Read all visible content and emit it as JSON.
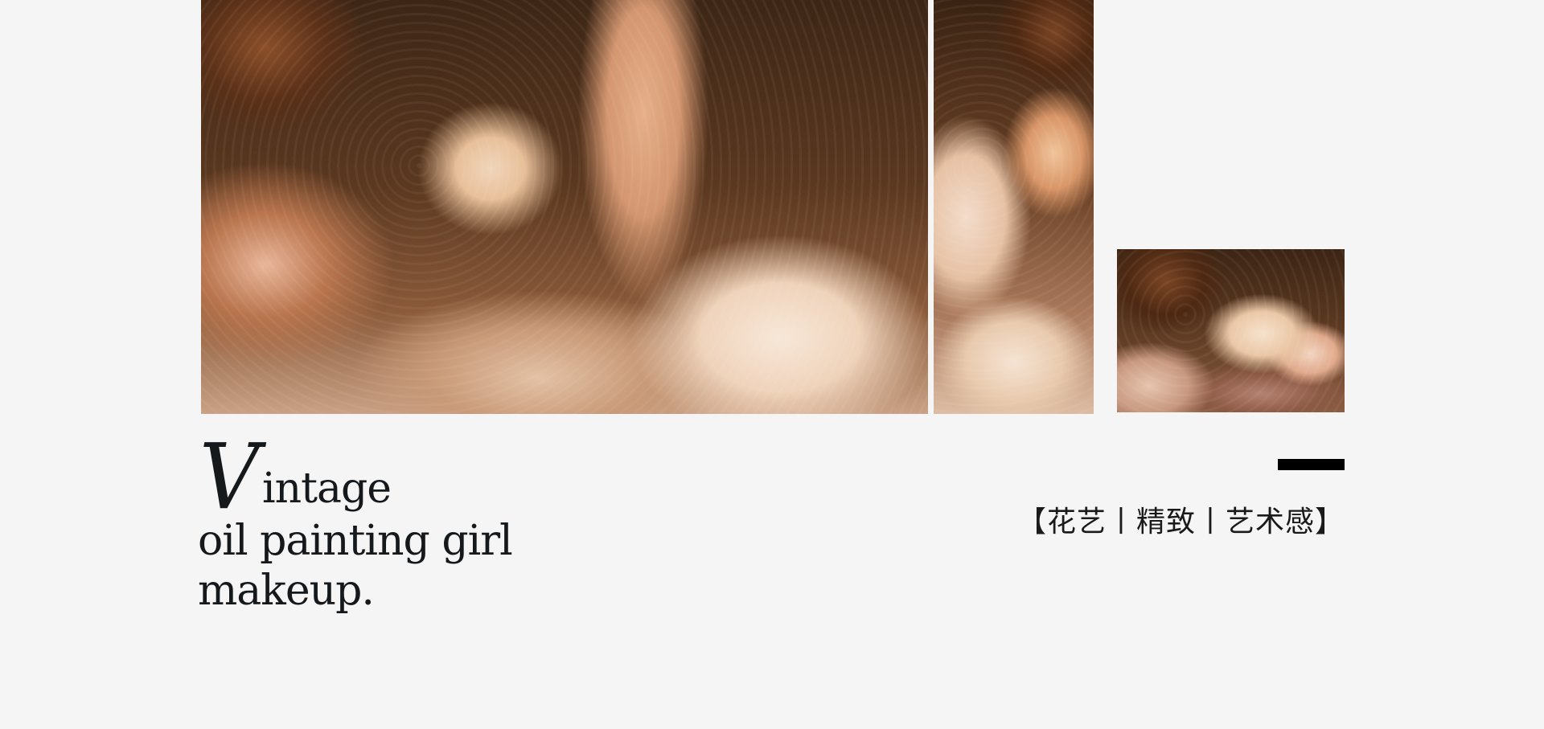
{
  "photos": {
    "main": "oil-painting-bride-photo",
    "side": "bride-side-photo",
    "thumb": "flower-bouquet-photo"
  },
  "title": {
    "initial": "V",
    "rest": "intage",
    "line2": "oil painting girl",
    "line3": "makeup."
  },
  "tag": {
    "text": "【花艺丨精致丨艺术感】"
  },
  "colors": {
    "background": "#f5f5f5",
    "text": "#16191c",
    "accent_bar": "#000000"
  }
}
